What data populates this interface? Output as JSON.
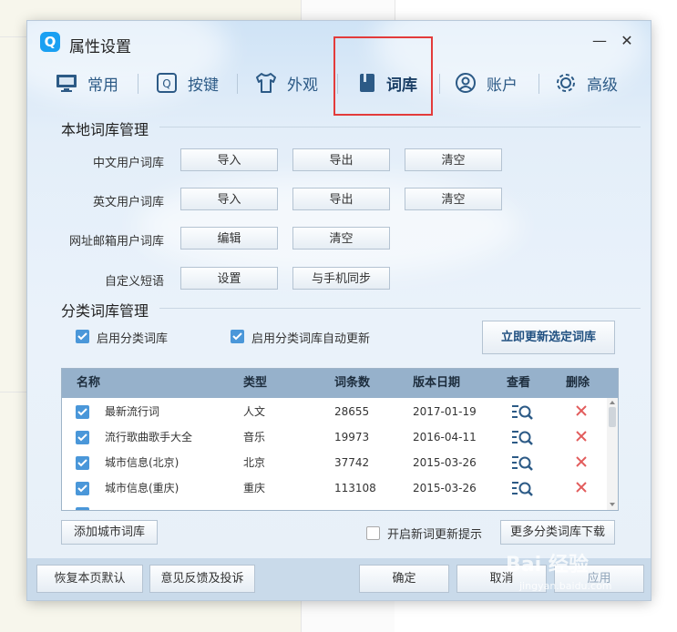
{
  "window": {
    "logo": "Q",
    "title": "属性设置",
    "minimize": "—",
    "close": "✕"
  },
  "tabs": [
    {
      "label": "常用",
      "icon": "monitor-icon"
    },
    {
      "label": "按键",
      "icon": "key-icon"
    },
    {
      "label": "外观",
      "icon": "shirt-icon"
    },
    {
      "label": "词库",
      "icon": "book-icon",
      "active": true
    },
    {
      "label": "账户",
      "icon": "user-icon"
    },
    {
      "label": "高级",
      "icon": "gear-icon"
    }
  ],
  "local": {
    "title": "本地词库管理",
    "rows": [
      {
        "label": "中文用户词库",
        "buttons": [
          "导入",
          "导出",
          "清空"
        ]
      },
      {
        "label": "英文用户词库",
        "buttons": [
          "导入",
          "导出",
          "清空"
        ]
      },
      {
        "label": "网址邮箱用户词库",
        "buttons": [
          "编辑",
          "清空"
        ]
      },
      {
        "label": "自定义短语",
        "buttons": [
          "设置",
          "与手机同步"
        ]
      }
    ]
  },
  "category": {
    "title": "分类词库管理",
    "enable_label": "启用分类词库",
    "auto_update_label": "启用分类词库自动更新",
    "update_now_label": "立即更新选定词库",
    "columns": [
      "名称",
      "类型",
      "词条数",
      "版本日期",
      "查看",
      "删除"
    ],
    "rows": [
      {
        "name": "最新流行词",
        "type": "人文",
        "count": "28655",
        "date": "2017-01-19"
      },
      {
        "name": "流行歌曲歌手大全",
        "type": "音乐",
        "count": "19973",
        "date": "2016-04-11"
      },
      {
        "name": "城市信息(北京)",
        "type": "北京",
        "count": "37742",
        "date": "2015-03-26"
      },
      {
        "name": "城市信息(重庆)",
        "type": "重庆",
        "count": "113108",
        "date": "2015-03-26"
      }
    ],
    "add_city_label": "添加城市词库",
    "new_word_tip_label": "开启新词更新提示",
    "more_download_label": "更多分类词库下载"
  },
  "footer": {
    "restore_label": "恢复本页默认",
    "feedback_label": "意见反馈及投诉",
    "ok_label": "确定",
    "cancel_label": "取消",
    "apply_label": "应用"
  },
  "watermark": {
    "main": "Bai 经验",
    "sub": "jingyan.baidu.com"
  },
  "colors": {
    "accent": "#4a97d9",
    "header": "#96b1cb",
    "highlight": "#e33b3b",
    "delete": "#e25c5c"
  }
}
